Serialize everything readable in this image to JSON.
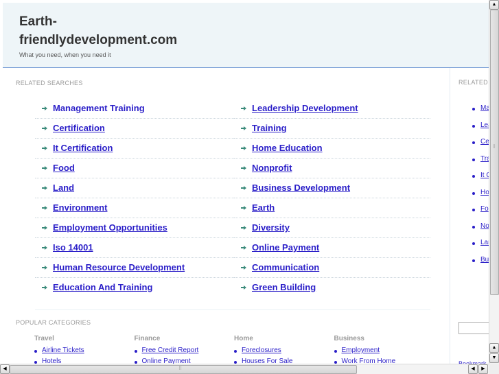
{
  "header": {
    "title_line1": "Earth-",
    "title_line2": "friendlydevelopment.com",
    "tagline": "What you need, when you need it"
  },
  "related_searches": {
    "heading": "RELATED SEARCHES",
    "left": [
      {
        "label": "Management Training",
        "hovered": true
      },
      {
        "label": "Certification"
      },
      {
        "label": "It Certification"
      },
      {
        "label": "Food"
      },
      {
        "label": "Land"
      },
      {
        "label": "Environment"
      },
      {
        "label": "Employment Opportunities"
      },
      {
        "label": "Iso 14001"
      },
      {
        "label": "Human Resource Development"
      },
      {
        "label": "Education And Training"
      }
    ],
    "right": [
      {
        "label": "Leadership Development"
      },
      {
        "label": "Training"
      },
      {
        "label": "Home Education"
      },
      {
        "label": "Nonprofit"
      },
      {
        "label": "Business Development"
      },
      {
        "label": "Earth"
      },
      {
        "label": "Diversity"
      },
      {
        "label": "Online Payment"
      },
      {
        "label": "Communication"
      },
      {
        "label": "Green Building"
      }
    ]
  },
  "popular_categories": {
    "heading": "POPULAR CATEGORIES",
    "categories": [
      {
        "title": "Travel",
        "items": [
          "Airline Tickets",
          "Hotels"
        ]
      },
      {
        "title": "Finance",
        "items": [
          "Free Credit Report",
          "Online Payment"
        ]
      },
      {
        "title": "Home",
        "items": [
          "Foreclosures",
          "Houses For Sale"
        ]
      },
      {
        "title": "Business",
        "items": [
          "Employment",
          "Work From Home"
        ]
      }
    ]
  },
  "sidebar": {
    "heading": "RELATED",
    "items": [
      "Ma",
      "Lea",
      "Ce",
      "Tra",
      "It C",
      "Ho",
      "Fo",
      "No",
      "Lar",
      "Bus"
    ],
    "bookmark_label": "Bookmark"
  },
  "scrollbars": {
    "vertical_up": "▲",
    "vertical_down": "▼",
    "horizontal_left": "◀",
    "horizontal_right": "▶",
    "grip": "⠿"
  },
  "colors": {
    "link": "#2a1ec8",
    "arrow": "#3a8a7a",
    "header_bg": "#eef5f8",
    "header_border": "#7a9fd6"
  }
}
